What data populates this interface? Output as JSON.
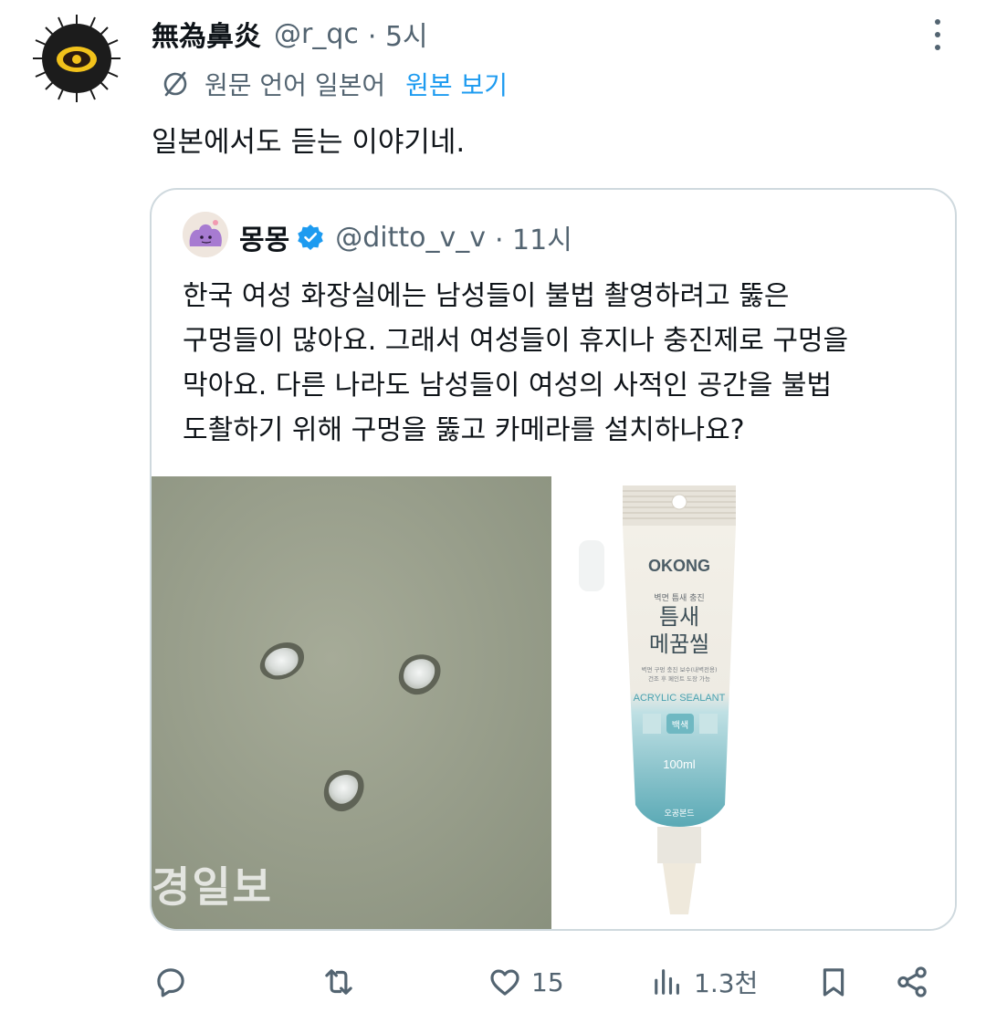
{
  "tweet": {
    "author_name": "無為鼻炎",
    "handle": "@r_qc",
    "time": "· 5시",
    "translate_note": "원문 언어 일본어",
    "show_original": "원본 보기",
    "text": "일본에서도 듣는 이야기네."
  },
  "quote": {
    "author_name": "몽몽",
    "handle": "@ditto_v_v",
    "time": "· 11시",
    "lines": [
      "한국 여성 화장실에는 남성들이 불법 촬영하려고 뚫은",
      "구멍들이 많아요. 그래서 여성들이 휴지나 충진제로 구멍을",
      "막아요. 다른 나라도 남성들이 여성의 사적인 공간을 불법",
      "도촬하기 위해 구멍을 뚫고 카메라를 설치하나요?"
    ],
    "image_left_watermark": "경일보",
    "product": {
      "brand": "OKONG",
      "small_line": "벽면 틈새 충진",
      "title_line1": "틈새",
      "title_line2": "메꿈씰",
      "desc_line1": "벽면 구멍 충진 보수(내벽전용)",
      "desc_line2": "건조 후 페인트 도장 가능",
      "type": "ACRYLIC SEALANT",
      "color_badge": "백색",
      "volume": "100ml",
      "maker": "오공본드"
    }
  },
  "actions": {
    "reply_count": "",
    "retweet_count": "",
    "like_count": "15",
    "views_count": "1.3천"
  },
  "colors": {
    "text": "#0f1419",
    "muted": "#536471",
    "link": "#1d9bf0",
    "border": "#cfd9de"
  }
}
